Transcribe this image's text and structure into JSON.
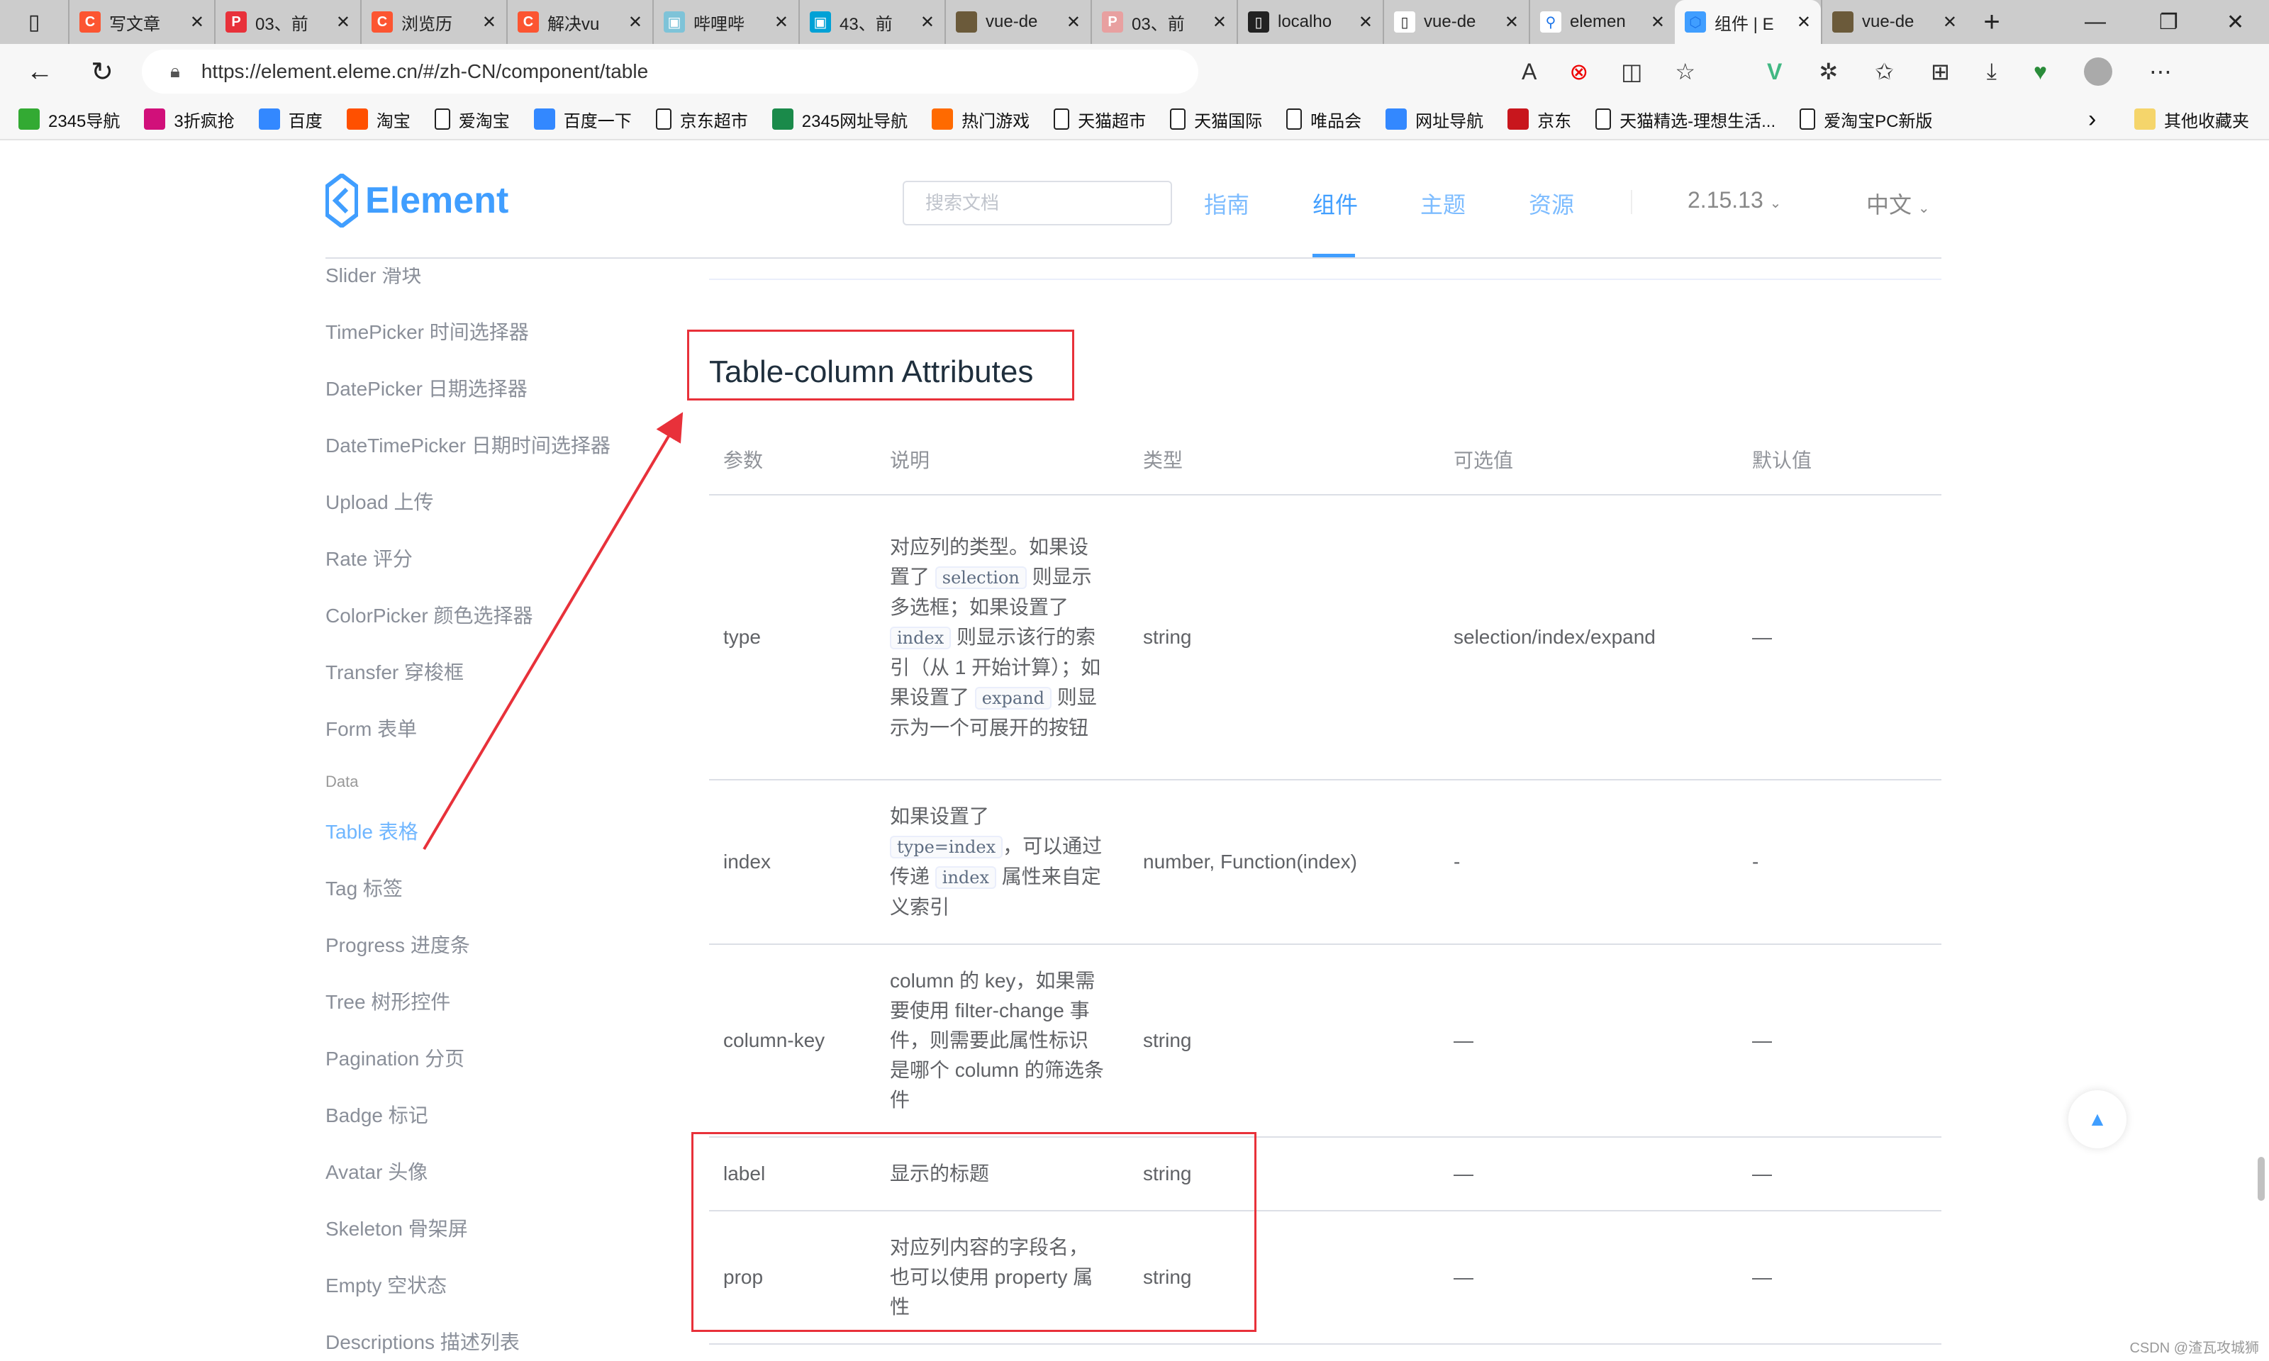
{
  "browser": {
    "tabs": [
      {
        "label": "写文章",
        "icon": "csdn-icon",
        "color": "#fc5531"
      },
      {
        "label": "03、前",
        "icon": "pdf-icon",
        "color": "#e8313a"
      },
      {
        "label": "浏览历",
        "icon": "csdn-icon",
        "color": "#fc5531"
      },
      {
        "label": "解决vu",
        "icon": "csdn-icon",
        "color": "#fc5531"
      },
      {
        "label": "哔哩哔",
        "icon": "bilibili-icon",
        "color": "#7ec3d8"
      },
      {
        "label": "43、前",
        "icon": "bilibili-icon",
        "color": "#00a1d6"
      },
      {
        "label": "vue-de",
        "icon": "avatar-icon",
        "color": "#6b5a3a"
      },
      {
        "label": "03、前",
        "icon": "pdf-icon",
        "color": "#e8a0a0"
      },
      {
        "label": "localho",
        "icon": "file-error-icon",
        "color": "#222222"
      },
      {
        "label": "vue-de",
        "icon": "file-icon",
        "color": "#ffffff"
      },
      {
        "label": "elemen",
        "icon": "search-icon",
        "color": "#ffffff"
      },
      {
        "label": "组件 | E",
        "icon": "element-icon",
        "color": "#409eff",
        "active": true
      },
      {
        "label": "vue-de",
        "icon": "avatar-icon",
        "color": "#6b5a3a"
      }
    ],
    "close_glyph": "✕",
    "url": "https://element.eleme.cn/#/zh-CN/component/table",
    "bookmarks": [
      "2345导航",
      "3折疯抢",
      "百度",
      "淘宝",
      "爱淘宝",
      "百度一下",
      "京东超市",
      "2345网址导航",
      "热门游戏",
      "天猫超市",
      "天猫国际",
      "唯品会",
      "网址导航",
      "京东",
      "天猫精选-理想生活...",
      "爱淘宝PC新版"
    ],
    "other_bookmarks": "其他收藏夹"
  },
  "header": {
    "logo_text": "Element",
    "search_placeholder": "搜索文档",
    "nav": [
      "指南",
      "组件",
      "主题",
      "资源"
    ],
    "active_nav": "组件",
    "version": "2.15.13",
    "language": "中文"
  },
  "sidebar": {
    "items_before": [
      "Slider 滑块",
      "TimePicker 时间选择器",
      "DatePicker 日期选择器",
      "DateTimePicker 日期时间选择器",
      "Upload 上传",
      "Rate 评分",
      "ColorPicker 颜色选择器",
      "Transfer 穿梭框",
      "Form 表单"
    ],
    "group": "Data",
    "items_after": [
      "Table 表格",
      "Tag 标签",
      "Progress 进度条",
      "Tree 树形控件",
      "Pagination 分页",
      "Badge 标记",
      "Avatar 头像",
      "Skeleton 骨架屏",
      "Empty 空状态",
      "Descriptions 描述列表"
    ],
    "active": "Table 表格"
  },
  "main": {
    "title": "Table-column Attributes",
    "columns": [
      "参数",
      "说明",
      "类型",
      "可选值",
      "默认值"
    ],
    "rows": [
      {
        "param": "type",
        "desc": [
          [
            "t",
            "对应列的类型。如果设置了 "
          ],
          [
            "c",
            "selection"
          ],
          [
            "t",
            " 则显示多选框；如果设置了 "
          ],
          [
            "c",
            "index"
          ],
          [
            "t",
            " 则显示该行的索引（从 1 开始计算）；如果设置了 "
          ],
          [
            "c",
            "expand"
          ],
          [
            "t",
            " 则显示为一个可展开的按钮"
          ]
        ],
        "type": "string",
        "options": "selection/index/expand",
        "default": "—"
      },
      {
        "param": "index",
        "desc": [
          [
            "t",
            "如果设置了 "
          ],
          [
            "c",
            "type=index"
          ],
          [
            "t",
            "，可以通过传递 "
          ],
          [
            "c",
            "index"
          ],
          [
            "t",
            " 属性来自定义索引"
          ]
        ],
        "type": "number, Function(index)",
        "options": "-",
        "default": "-"
      },
      {
        "param": "column-key",
        "desc": [
          [
            "t",
            "column 的 key，如果需要使用 filter-change 事件，则需要此属性标识是哪个 column 的筛选条件"
          ]
        ],
        "type": "string",
        "options": "—",
        "default": "—"
      },
      {
        "param": "label",
        "desc": [
          [
            "t",
            "显示的标题"
          ]
        ],
        "type": "string",
        "options": "—",
        "default": "—"
      },
      {
        "param": "prop",
        "desc": [
          [
            "t",
            "对应列内容的字段名，也可以使用 property 属性"
          ]
        ],
        "type": "string",
        "options": "—",
        "default": "—"
      }
    ]
  },
  "annotation_color": "#e8313a",
  "watermark": "CSDN @渣瓦攻城狮"
}
